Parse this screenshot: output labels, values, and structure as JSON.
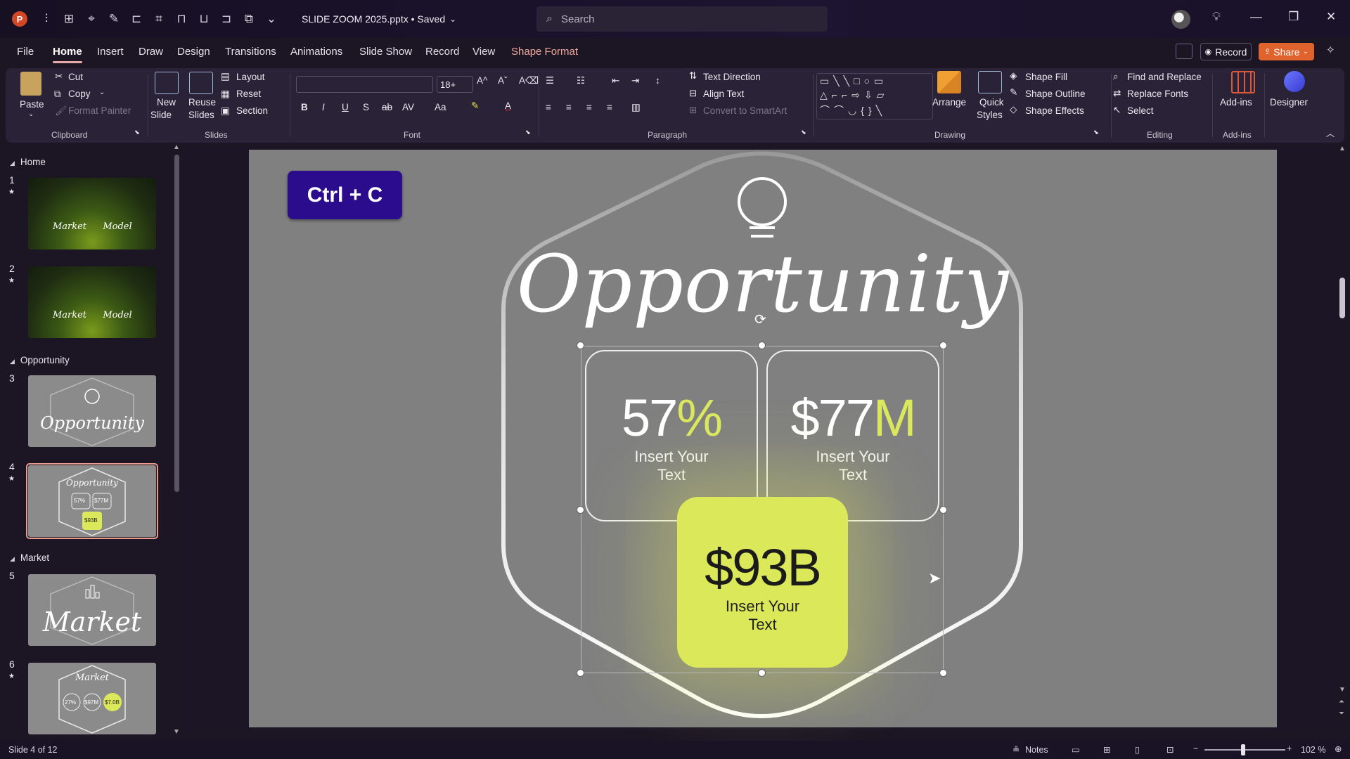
{
  "titlebar": {
    "doc_title": "SLIDE ZOOM 2025.pptx • Saved",
    "search_placeholder": "Search"
  },
  "menu": {
    "tabs": [
      "File",
      "Home",
      "Insert",
      "Draw",
      "Design",
      "Transitions",
      "Animations",
      "Slide Show",
      "Record",
      "View",
      "Shape Format"
    ],
    "active": "Home",
    "record": "Record",
    "share": "Share"
  },
  "ribbon": {
    "clipboard": {
      "paste": "Paste",
      "cut": "Cut",
      "copy": "Copy",
      "format_painter": "Format Painter",
      "label": "Clipboard"
    },
    "slides": {
      "new_slide": "New",
      "new_slide2": "Slide",
      "reuse": "Reuse",
      "reuse2": "Slides",
      "layout": "Layout",
      "reset": "Reset",
      "section": "Section",
      "label": "Slides"
    },
    "font": {
      "size": "18+",
      "label": "Font"
    },
    "paragraph": {
      "text_direction": "Text Direction",
      "align_text": "Align Text",
      "convert": "Convert to SmartArt",
      "label": "Paragraph"
    },
    "drawing": {
      "arrange": "Arrange",
      "quick": "Quick",
      "quick2": "Styles",
      "shape_fill": "Shape Fill",
      "shape_outline": "Shape Outline",
      "shape_effects": "Shape Effects",
      "label": "Drawing"
    },
    "editing": {
      "find_replace": "Find and Replace",
      "replace_fonts": "Replace Fonts",
      "select": "Select",
      "label": "Editing"
    },
    "addins": {
      "addins": "Add-ins",
      "label": "Add-ins"
    },
    "designer": {
      "designer": "Designer"
    }
  },
  "pane": {
    "sections": [
      "Home",
      "Opportunity",
      "Market"
    ],
    "slide_numbers": [
      "1",
      "2",
      "3",
      "4",
      "5",
      "6"
    ],
    "thumb_texts": {
      "market": "Market",
      "model": "Model",
      "opportunity": "Opportunity",
      "t4_57": "57%",
      "t4_77": "$77M",
      "t4_93": "$93B",
      "t6_27": "27%",
      "t6_97": "$97M",
      "t6_7": "$7.0B"
    }
  },
  "slide": {
    "badge": "Ctrl + C",
    "headline": "Opportunity",
    "card1": {
      "value": "57",
      "unit": "%",
      "text1": "Insert Your",
      "text2": "Text"
    },
    "card2": {
      "value": "$77",
      "unit": "M",
      "text1": "Insert Your",
      "text2": "Text"
    },
    "card3": {
      "value": "$93B",
      "text1": "Insert Your",
      "text2": "Text"
    }
  },
  "status": {
    "slide_info": "Slide 4 of 12",
    "notes": "Notes",
    "zoom": "102 %"
  },
  "colors": {
    "accent_green": "#dbe85a",
    "badge_purple": "#2b0c8c",
    "share_orange": "#e0632e"
  }
}
